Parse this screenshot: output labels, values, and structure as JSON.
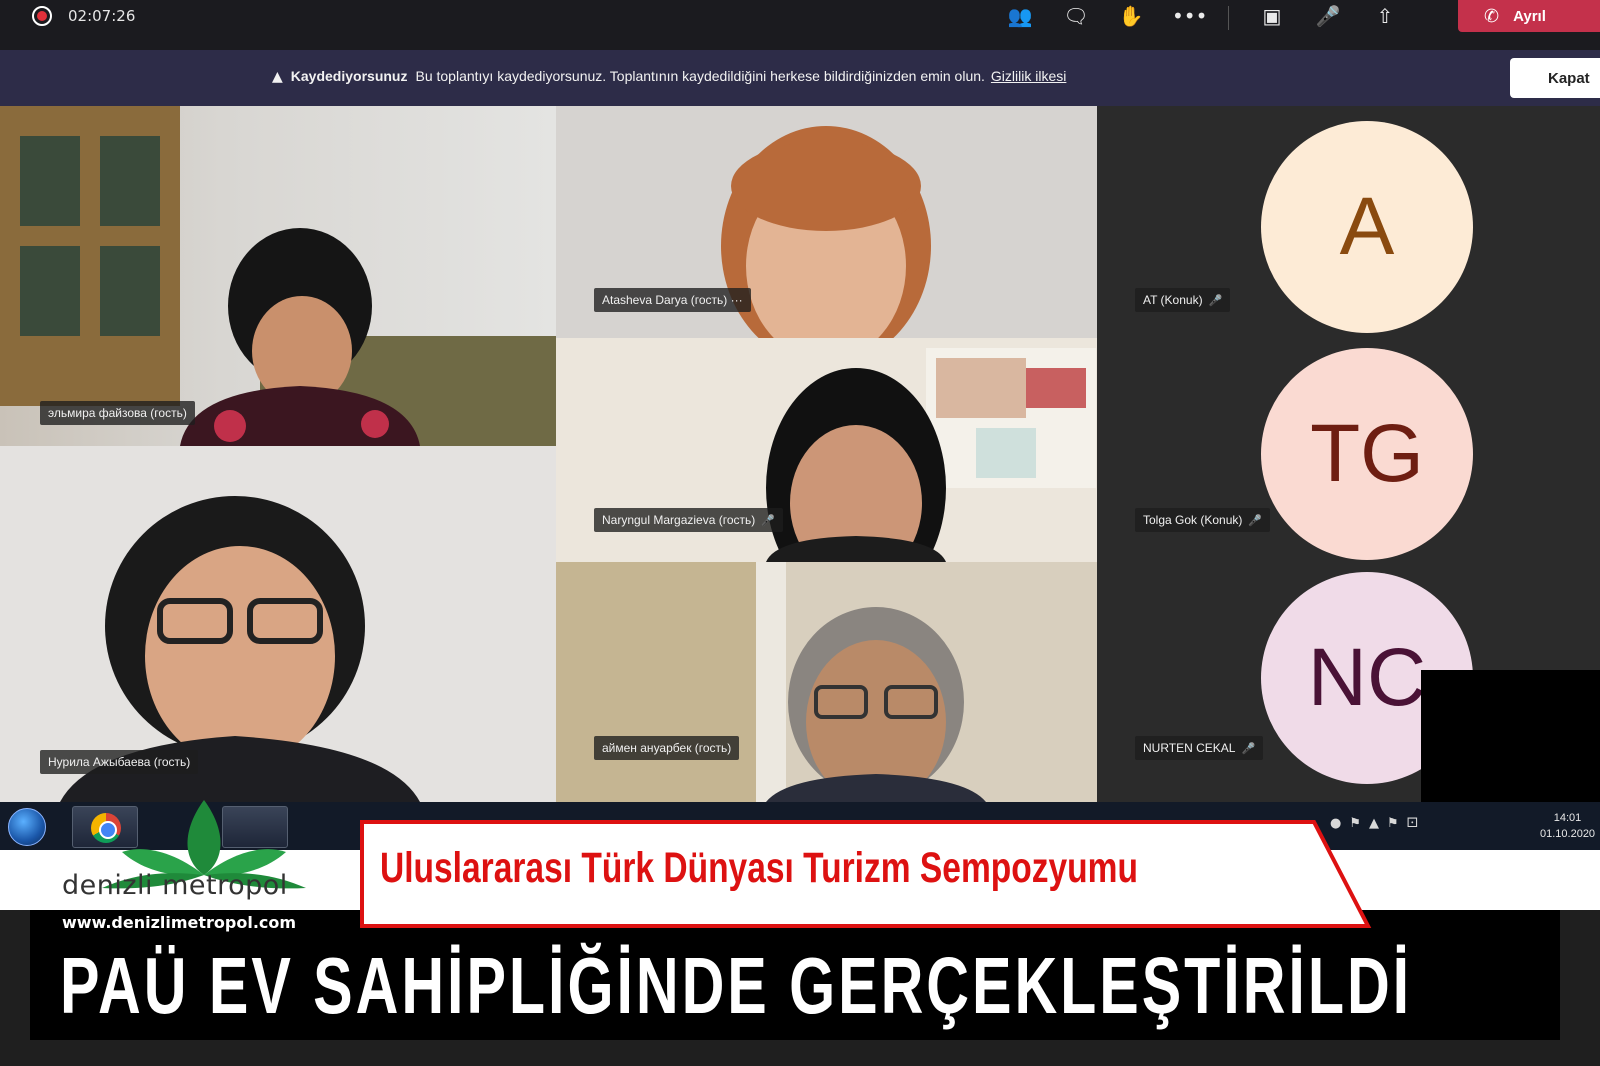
{
  "teams": {
    "timer": "02:07:26",
    "toolbar_icons": [
      "participants-icon",
      "chat-icon",
      "raise-hand-icon",
      "more-options-icon",
      "camera-icon",
      "microphone-icon",
      "share-screen-icon"
    ],
    "leave_label": "Ayrıl"
  },
  "banner": {
    "title": "Kaydediyorsunuz",
    "message": "Bu toplantıyı kaydediyorsunuz. Toplantının kaydedildiğini herkese bildirdiğinizden emin olun.",
    "link": "Gizlilik ilkesi",
    "close_label": "Kapat"
  },
  "participants": [
    {
      "name": "эльмира файзова (гость)",
      "mic": false
    },
    {
      "name": "Atasheva Darya (гость)",
      "mic": false,
      "more": "···"
    },
    {
      "name": "Naryngul Margazieva (гость)",
      "mic": true
    },
    {
      "name": "Нурила Ажыбаева (гость)",
      "mic": false
    },
    {
      "name": "аймен ануарбек (гость)",
      "mic": false
    },
    {
      "name": "AT (Konuk)",
      "initials": "A",
      "mic": true,
      "avatar_bg": "#fdebd6",
      "avatar_fg": "#8a4a0f"
    },
    {
      "name": "Tolga Gok (Konuk)",
      "initials": "TG",
      "mic": true,
      "avatar_bg": "#fadad2",
      "avatar_fg": "#6e1e12"
    },
    {
      "name": "NURTEN CEKAL",
      "initials": "NC",
      "mic": true,
      "avatar_bg": "#f0dbe8",
      "avatar_fg": "#4a1236"
    }
  ],
  "taskbar": {
    "clock_time": "14:01",
    "clock_date": "01.10.2020"
  },
  "branding": {
    "logo_name": "denizli metropol",
    "logo_url": "www.denizlimetropol.com",
    "subtitle": "Uluslararası Türk Dünyası Turizm Sempozyumu",
    "headline": "PAÜ EV SAHİPLİĞİNDE GERÇEKLEŞTİRİLDİ",
    "accent": "#dd1111"
  }
}
